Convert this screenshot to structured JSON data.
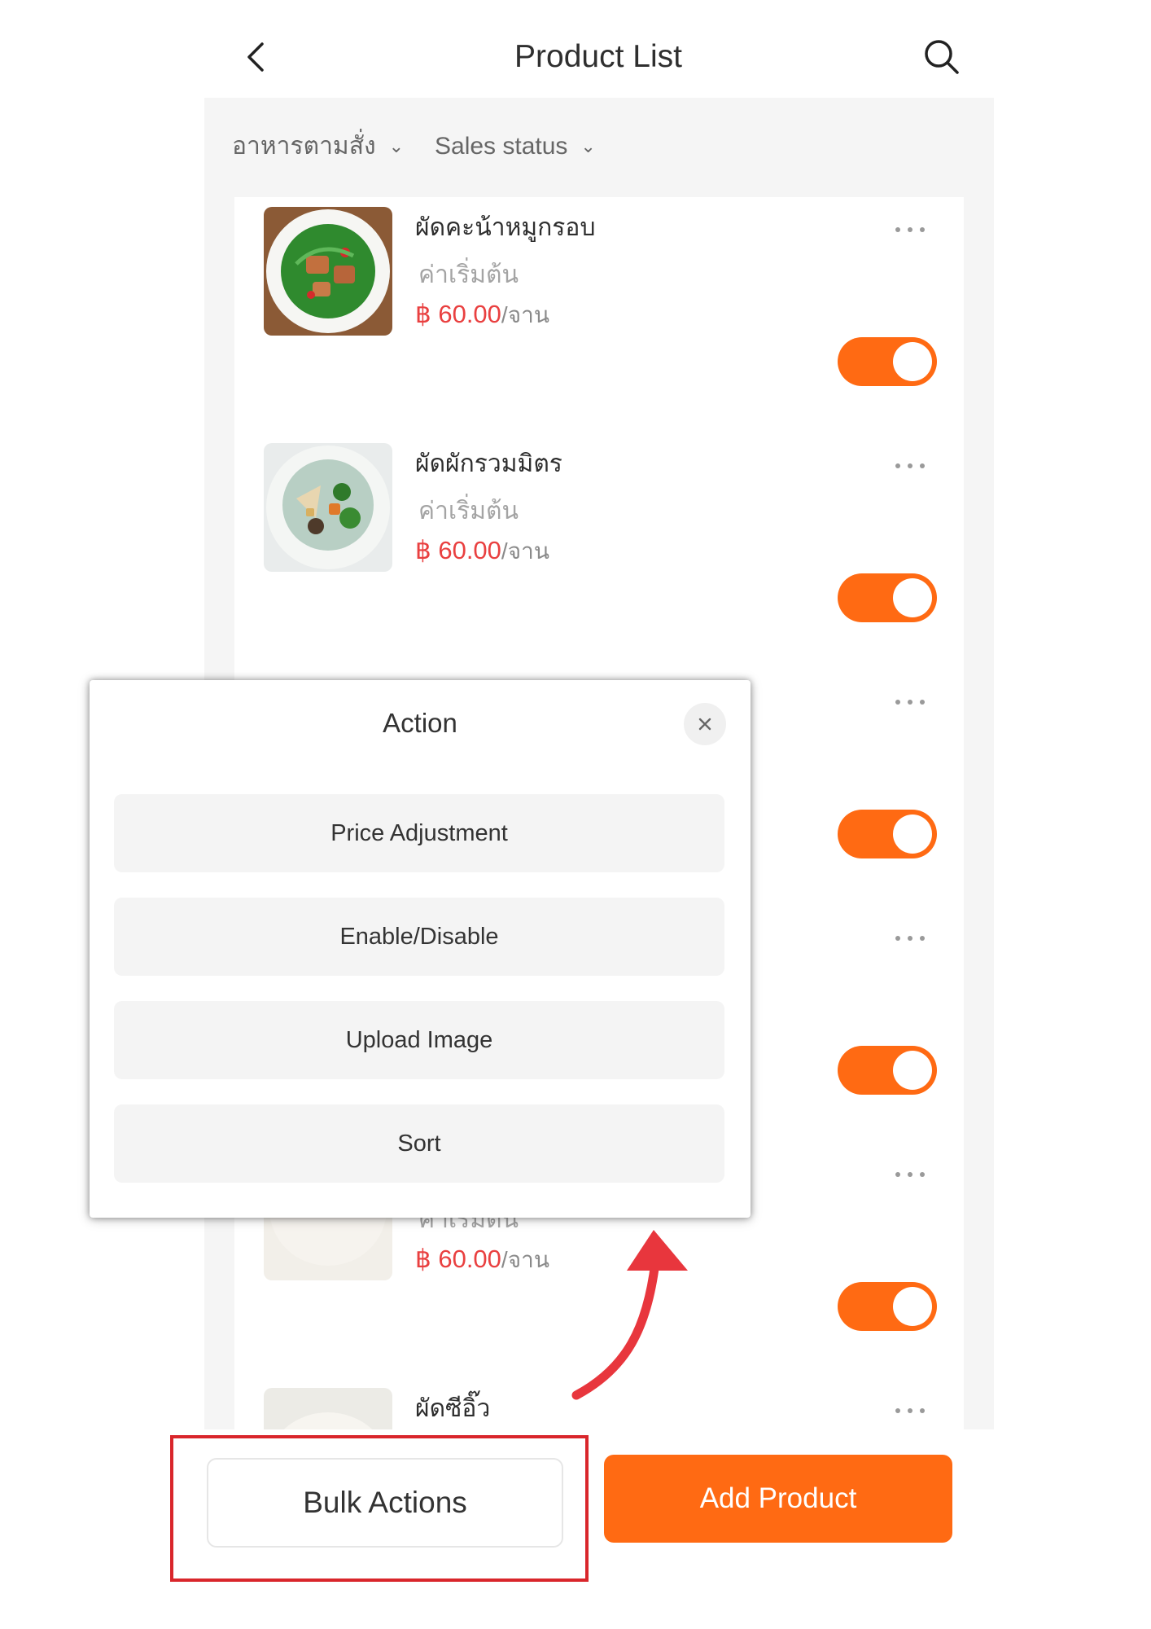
{
  "header": {
    "title": "Product List",
    "back_icon": "chevron-left-icon",
    "search_icon": "search-icon"
  },
  "filters": [
    {
      "label": "อาหารตามสั่ง",
      "icon": "chevron-down-icon"
    },
    {
      "label": "Sales status",
      "icon": "chevron-down-icon"
    }
  ],
  "products": [
    {
      "name": "ผัดคะน้าหมูกรอบ",
      "subtitle": "ค่าเริ่มต้น",
      "price": "฿ 60.00",
      "unit": "/จาน",
      "enabled": true
    },
    {
      "name": "ผัดผักรวมมิตร",
      "subtitle": "ค่าเริ่มต้น",
      "price": "฿ 60.00",
      "unit": "/จาน",
      "enabled": true
    },
    {
      "name": "",
      "subtitle": "",
      "price": "",
      "unit": "",
      "enabled": true
    },
    {
      "name": "",
      "subtitle": "",
      "price": "",
      "unit": "",
      "enabled": true
    },
    {
      "name": "",
      "subtitle": "ค่าเริ่มต้น",
      "price": "฿ 60.00",
      "unit": "/จาน",
      "enabled": true
    },
    {
      "name": "ผัดซีอิ๊ว",
      "subtitle": "",
      "price": "",
      "unit": "",
      "enabled": true
    }
  ],
  "modal": {
    "title": "Action",
    "close_icon": "close-icon",
    "buttons": [
      "Price Adjustment",
      "Enable/Disable",
      "Upload Image",
      "Sort"
    ]
  },
  "footer": {
    "bulk_label": "Bulk Actions",
    "add_label": "Add Product"
  },
  "colors": {
    "accent": "#ff6a13",
    "price": "#e94040",
    "highlight": "#d9262b"
  }
}
